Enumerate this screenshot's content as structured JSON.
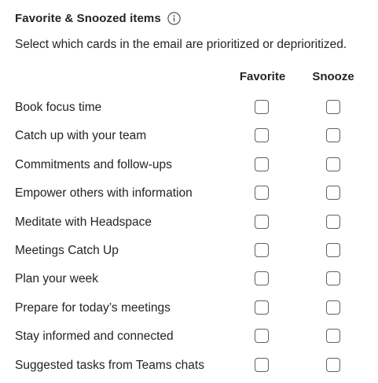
{
  "header": {
    "title": "Favorite & Snoozed items",
    "info_icon": "info-circle-icon"
  },
  "subtitle": "Select which cards in the email are prioritized or deprioritized.",
  "columns": {
    "favorite": "Favorite",
    "snooze": "Snooze"
  },
  "items": [
    {
      "label": "Book focus time",
      "favorite": false,
      "snooze": false
    },
    {
      "label": "Catch up with your team",
      "favorite": false,
      "snooze": false
    },
    {
      "label": "Commitments and follow-ups",
      "favorite": false,
      "snooze": false
    },
    {
      "label": "Empower others with information",
      "favorite": false,
      "snooze": false
    },
    {
      "label": "Meditate with Headspace",
      "favorite": false,
      "snooze": false
    },
    {
      "label": "Meetings Catch Up",
      "favorite": false,
      "snooze": false
    },
    {
      "label": "Plan your week",
      "favorite": false,
      "snooze": false
    },
    {
      "label": "Prepare for today’s meetings",
      "favorite": false,
      "snooze": false
    },
    {
      "label": "Stay informed and connected",
      "favorite": false,
      "snooze": false
    },
    {
      "label": "Suggested tasks from Teams chats",
      "favorite": false,
      "snooze": false
    }
  ],
  "colors": {
    "text": "#242424",
    "checkbox_border": "#616161"
  }
}
